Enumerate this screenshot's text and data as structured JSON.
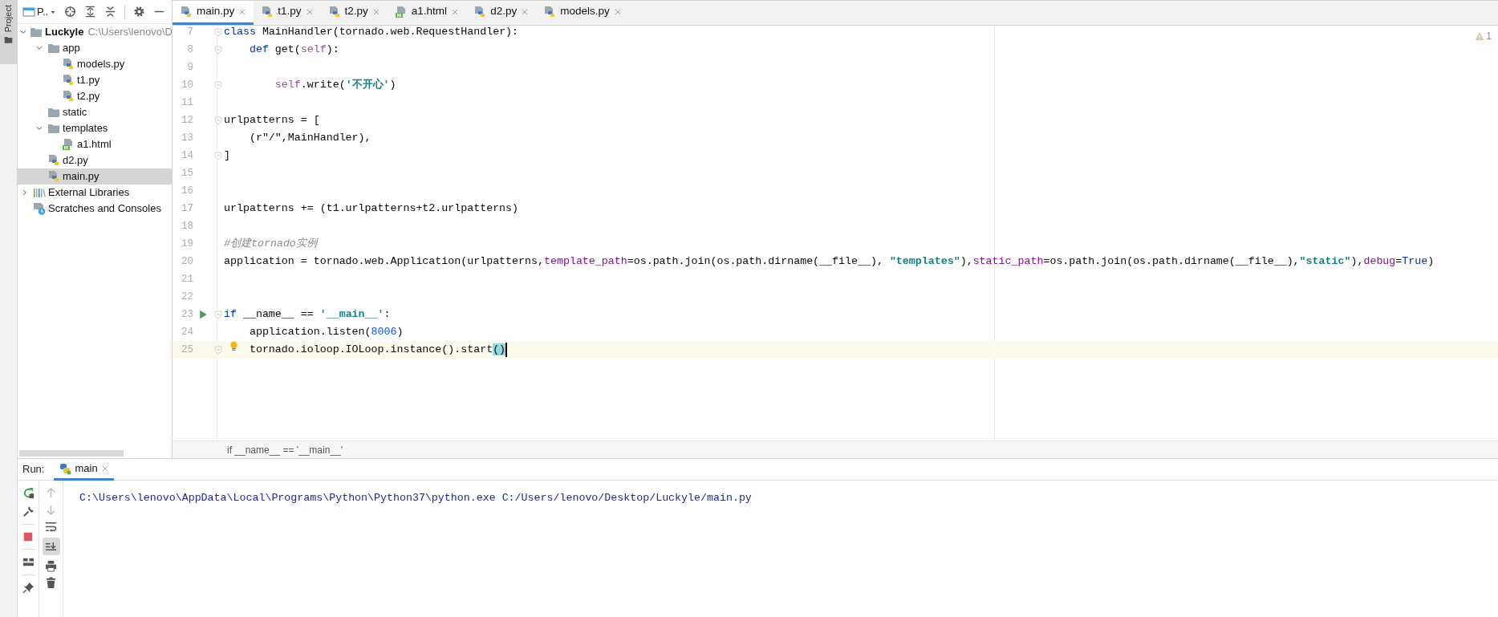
{
  "tool_strip": {
    "label": "Project"
  },
  "project_panel": {
    "title": "P..",
    "tree": [
      {
        "label": "Luckyle",
        "kind": "project",
        "path": "C:\\Users\\lenovo\\D",
        "expanded": true,
        "selected": false,
        "children": [
          {
            "label": "app",
            "kind": "folder",
            "expanded": true,
            "selected": false,
            "children": [
              {
                "label": "models.py",
                "kind": "py",
                "selected": false
              },
              {
                "label": "t1.py",
                "kind": "py",
                "selected": false
              },
              {
                "label": "t2.py",
                "kind": "py",
                "selected": false
              }
            ]
          },
          {
            "label": "static",
            "kind": "folder",
            "selected": false
          },
          {
            "label": "templates",
            "kind": "folder",
            "expanded": true,
            "selected": false,
            "children": [
              {
                "label": "a1.html",
                "kind": "html",
                "selected": false
              }
            ]
          },
          {
            "label": "d2.py",
            "kind": "py",
            "selected": false
          },
          {
            "label": "main.py",
            "kind": "py",
            "selected": true
          }
        ]
      },
      {
        "label": "External Libraries",
        "kind": "library",
        "expanded": false,
        "selected": false
      },
      {
        "label": "Scratches and Consoles",
        "kind": "scratch",
        "selected": false
      }
    ]
  },
  "editor": {
    "tabs": [
      {
        "label": "main.py",
        "kind": "py",
        "selected": true
      },
      {
        "label": "t1.py",
        "kind": "py",
        "selected": false
      },
      {
        "label": "t2.py",
        "kind": "py",
        "selected": false
      },
      {
        "label": "a1.html",
        "kind": "html",
        "selected": false
      },
      {
        "label": "d2.py",
        "kind": "py",
        "selected": false
      },
      {
        "label": "models.py",
        "kind": "py",
        "selected": false
      }
    ],
    "warning_count": "1",
    "lines": [
      {
        "number": "7",
        "fold": true,
        "run": false,
        "current": false,
        "intention": false,
        "segments": [
          {
            "kind": "keyword",
            "text": "class "
          },
          {
            "kind": "plain",
            "text": "MainHandler(tornado.web.RequestHandler):"
          }
        ]
      },
      {
        "number": "8",
        "fold": true,
        "run": false,
        "current": false,
        "intention": false,
        "segments": [
          {
            "kind": "keyword",
            "text": "    def "
          },
          {
            "kind": "plain",
            "text": "get("
          },
          {
            "kind": "self",
            "text": "self"
          },
          {
            "kind": "plain",
            "text": "):"
          }
        ]
      },
      {
        "number": "9",
        "fold": false,
        "run": false,
        "current": false,
        "intention": false
      },
      {
        "number": "10",
        "fold": true,
        "run": false,
        "current": false,
        "intention": false,
        "segments": [
          {
            "kind": "self",
            "text": "        self"
          },
          {
            "kind": "plain",
            "text": ".write("
          },
          {
            "kind": "string",
            "text": "'不开心'"
          },
          {
            "kind": "plain",
            "text": ")"
          }
        ]
      },
      {
        "number": "11",
        "fold": false,
        "run": false,
        "current": false,
        "intention": false
      },
      {
        "number": "12",
        "fold": true,
        "run": false,
        "current": false,
        "intention": false,
        "segments": [
          {
            "kind": "plain",
            "text": "urlpatterns = ["
          }
        ]
      },
      {
        "number": "13",
        "fold": false,
        "run": false,
        "current": false,
        "intention": false,
        "segments": [
          {
            "kind": "plain",
            "text": "    (r\"/\",MainHandler),"
          }
        ]
      },
      {
        "number": "14",
        "fold": true,
        "run": false,
        "current": false,
        "intention": false,
        "segments": [
          {
            "kind": "plain",
            "text": "]"
          }
        ]
      },
      {
        "number": "15",
        "fold": false,
        "run": false,
        "current": false,
        "intention": false
      },
      {
        "number": "16",
        "fold": false,
        "run": false,
        "current": false,
        "intention": false
      },
      {
        "number": "17",
        "fold": false,
        "run": false,
        "current": false,
        "intention": false,
        "segments": [
          {
            "kind": "plain",
            "text": "urlpatterns += (t1.urlpatterns+t2.urlpatterns)"
          }
        ]
      },
      {
        "number": "18",
        "fold": false,
        "run": false,
        "current": false,
        "intention": false
      },
      {
        "number": "19",
        "fold": false,
        "run": false,
        "current": false,
        "intention": false,
        "segments": [
          {
            "kind": "comment",
            "text": "#创建tornado实例"
          }
        ]
      },
      {
        "number": "20",
        "fold": false,
        "run": false,
        "current": false,
        "intention": false,
        "segments": [
          {
            "kind": "plain",
            "text": "application = tornado.web.Application(urlpatterns,"
          },
          {
            "kind": "param",
            "text": "template_path"
          },
          {
            "kind": "plain",
            "text": "=os.path.join(os.path.dirname(__file__), "
          },
          {
            "kind": "string",
            "text": "\"templates\""
          },
          {
            "kind": "plain",
            "text": "),"
          },
          {
            "kind": "param",
            "text": "static_path"
          },
          {
            "kind": "plain",
            "text": "=os.path.join(os.path.dirname(__file__),"
          },
          {
            "kind": "string",
            "text": "\"static\""
          },
          {
            "kind": "plain",
            "text": "),"
          },
          {
            "kind": "param",
            "text": "debug"
          },
          {
            "kind": "plain",
            "text": "="
          },
          {
            "kind": "keyword",
            "text": "True"
          },
          {
            "kind": "plain",
            "text": ")"
          }
        ]
      },
      {
        "number": "21",
        "fold": false,
        "run": false,
        "current": false,
        "intention": false
      },
      {
        "number": "22",
        "fold": false,
        "run": false,
        "current": false,
        "intention": false
      },
      {
        "number": "23",
        "fold": true,
        "run": true,
        "current": false,
        "intention": false,
        "segments": [
          {
            "kind": "keyword",
            "text": "if "
          },
          {
            "kind": "plain",
            "text": "__name__ == "
          },
          {
            "kind": "string",
            "text": "'__main__'"
          },
          {
            "kind": "plain",
            "text": ":"
          }
        ]
      },
      {
        "number": "24",
        "fold": false,
        "run": false,
        "current": false,
        "intention": false,
        "segments": [
          {
            "kind": "plain",
            "text": "    application.listen("
          },
          {
            "kind": "number",
            "text": "8006"
          },
          {
            "kind": "plain",
            "text": ")"
          }
        ]
      },
      {
        "number": "25",
        "fold": true,
        "run": false,
        "current": true,
        "intention": true,
        "segments": [
          {
            "kind": "plain",
            "text": "    tornado.ioloop.IOLoop.instance().start"
          },
          {
            "kind": "brace_match",
            "text": "()"
          }
        ]
      }
    ],
    "breadcrumb": "if __name__ == '__main__'"
  },
  "run_panel": {
    "label": "Run:",
    "tabs": [
      {
        "label": "main",
        "selected": true
      }
    ],
    "output": "C:\\Users\\lenovo\\AppData\\Local\\Programs\\Python\\Python37\\python.exe C:/Users/lenovo/Desktop/Luckyle/main.py"
  }
}
